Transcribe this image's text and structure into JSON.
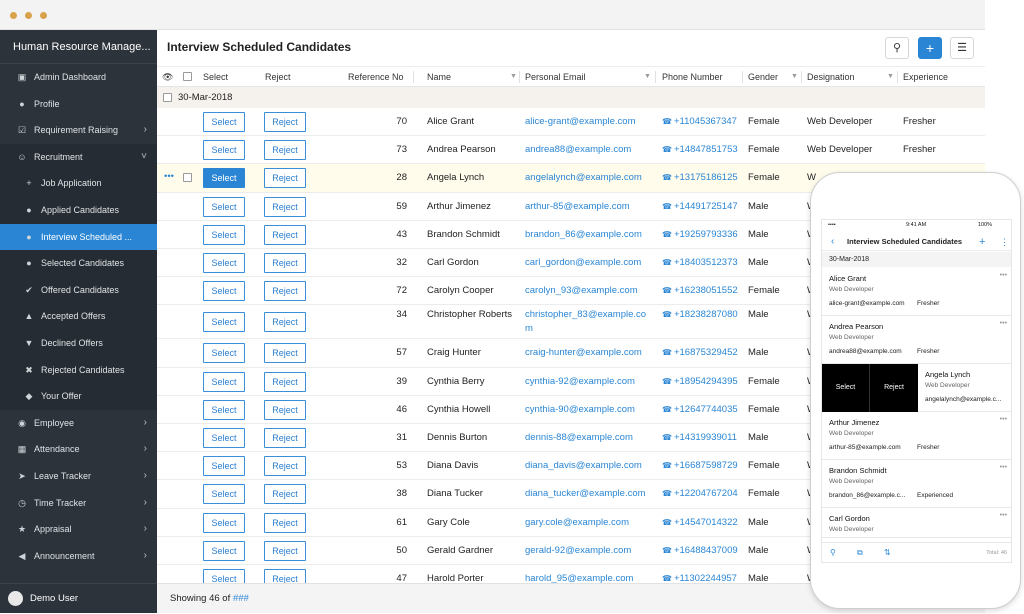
{
  "window": {
    "dots_color": "#d9a24a"
  },
  "sidebar": {
    "title": "Human Resource Manage...",
    "items": [
      {
        "label": "Admin Dashboard",
        "icon": "dashboard-icon"
      },
      {
        "label": "Profile",
        "icon": "user-icon"
      },
      {
        "label": "Requirement Raising",
        "icon": "checkbox-icon",
        "has_arrow": true
      },
      {
        "label": "Recruitment",
        "icon": "recruitment-icon",
        "expanded": true
      },
      {
        "label": "Job Application",
        "icon": "plus-icon",
        "sub": true
      },
      {
        "label": "Applied Candidates",
        "icon": "users-icon",
        "sub": true
      },
      {
        "label": "Interview Scheduled ...",
        "icon": "users-icon",
        "sub": true,
        "active": true
      },
      {
        "label": "Selected Candidates",
        "icon": "users-icon",
        "sub": true
      },
      {
        "label": "Offered Candidates",
        "icon": "check-circle-icon",
        "sub": true
      },
      {
        "label": "Accepted Offers",
        "icon": "thumbs-up-icon",
        "sub": true
      },
      {
        "label": "Declined Offers",
        "icon": "thumbs-down-icon",
        "sub": true
      },
      {
        "label": "Rejected Candidates",
        "icon": "x-icon",
        "sub": true
      },
      {
        "label": "Your Offer",
        "icon": "tag-icon",
        "sub": true
      },
      {
        "label": "Employee",
        "icon": "employee-icon",
        "has_arrow": true
      },
      {
        "label": "Attendance",
        "icon": "calendar-icon",
        "has_arrow": true
      },
      {
        "label": "Leave Tracker",
        "icon": "plane-icon",
        "has_arrow": true
      },
      {
        "label": "Time Tracker",
        "icon": "clock-icon",
        "has_arrow": true
      },
      {
        "label": "Appraisal",
        "icon": "star-icon",
        "has_arrow": true
      },
      {
        "label": "Announcement",
        "icon": "megaphone-icon",
        "has_arrow": true
      }
    ],
    "user": "Demo User"
  },
  "main": {
    "title": "Interview Scheduled Candidates",
    "columns": [
      "Select",
      "Reject",
      "Reference No",
      "Name",
      "Personal Email",
      "Phone Number",
      "Gender",
      "Designation",
      "Experience"
    ],
    "group_label": "30-Mar-2018",
    "select_label": "Select",
    "reject_label": "Reject",
    "rows": [
      {
        "ref": "70",
        "name": "Alice Grant",
        "email": "alice-grant@example.com",
        "phone": "+11045367347",
        "gender": "Female",
        "designation": "Web Developer",
        "experience": "Fresher"
      },
      {
        "ref": "73",
        "name": "Andrea Pearson",
        "email": "andrea88@example.com",
        "phone": "+14847851753",
        "gender": "Female",
        "designation": "Web Developer",
        "experience": "Fresher"
      },
      {
        "ref": "28",
        "name": "Angela Lynch",
        "email": "angelalynch@example.com",
        "phone": "+13175186125",
        "gender": "Female",
        "designation": "W",
        "experience": "",
        "highlight": true
      },
      {
        "ref": "59",
        "name": "Arthur Jimenez",
        "email": "arthur-85@example.com",
        "phone": "+14491725147",
        "gender": "Male",
        "designation": "W",
        "experience": ""
      },
      {
        "ref": "43",
        "name": "Brandon Schmidt",
        "email": "brandon_86@example.com",
        "phone": "+19259793336",
        "gender": "Male",
        "designation": "W",
        "experience": ""
      },
      {
        "ref": "32",
        "name": "Carl Gordon",
        "email": "carl_gordon@example.com",
        "phone": "+18403512373",
        "gender": "Male",
        "designation": "W",
        "experience": ""
      },
      {
        "ref": "72",
        "name": "Carolyn Cooper",
        "email": "carolyn_93@example.com",
        "phone": "+16238051552",
        "gender": "Female",
        "designation": "W",
        "experience": ""
      },
      {
        "ref": "34",
        "name": "Christopher Roberts",
        "email": "christopher_83@example.co",
        "email2": "m",
        "phone": "+18238287080",
        "gender": "Male",
        "designation": "W",
        "experience": "",
        "tall": true
      },
      {
        "ref": "57",
        "name": "Craig Hunter",
        "email": "craig-hunter@example.com",
        "phone": "+16875329452",
        "gender": "Male",
        "designation": "W",
        "experience": ""
      },
      {
        "ref": "39",
        "name": "Cynthia Berry",
        "email": "cynthia-92@example.com",
        "phone": "+18954294395",
        "gender": "Female",
        "designation": "W",
        "experience": ""
      },
      {
        "ref": "46",
        "name": "Cynthia Howell",
        "email": "cynthia-90@example.com",
        "phone": "+12647744035",
        "gender": "Female",
        "designation": "W",
        "experience": ""
      },
      {
        "ref": "31",
        "name": "Dennis Burton",
        "email": "dennis-88@example.com",
        "phone": "+14319939011",
        "gender": "Male",
        "designation": "W",
        "experience": ""
      },
      {
        "ref": "53",
        "name": "Diana Davis",
        "email": "diana_davis@example.com",
        "phone": "+16687598729",
        "gender": "Female",
        "designation": "W",
        "experience": ""
      },
      {
        "ref": "38",
        "name": "Diana Tucker",
        "email": "diana_tucker@example.com",
        "phone": "+12204767204",
        "gender": "Female",
        "designation": "W",
        "experience": ""
      },
      {
        "ref": "61",
        "name": "Gary Cole",
        "email": "gary.cole@example.com",
        "phone": "+14547014322",
        "gender": "Male",
        "designation": "W",
        "experience": ""
      },
      {
        "ref": "50",
        "name": "Gerald Gardner",
        "email": "gerald-92@example.com",
        "phone": "+16488437009",
        "gender": "Male",
        "designation": "W",
        "experience": ""
      },
      {
        "ref": "47",
        "name": "Harold Porter",
        "email": "harold_95@example.com",
        "phone": "+11302244957",
        "gender": "Male",
        "designation": "W",
        "experience": ""
      }
    ],
    "footer": {
      "prefix": "Showing 46 of",
      "total": "###"
    }
  },
  "mobile": {
    "status_time": "9:41 AM",
    "status_battery": "100%",
    "title": "Interview Scheduled Candidates",
    "date": "30-Mar-2018",
    "swipe_select": "Select",
    "swipe_reject": "Reject",
    "cards": [
      {
        "name": "Alice Grant",
        "role": "Web Developer",
        "email": "alice-grant@example.com",
        "exp": "Fresher"
      },
      {
        "name": "Andrea Pearson",
        "role": "Web Developer",
        "email": "andrea88@example.com",
        "exp": "Fresher"
      },
      {
        "name": "Angela Lynch",
        "role": "Web Developer",
        "email": "angelalynch@example.c...",
        "exp": "",
        "swiped": true
      },
      {
        "name": "Arthur Jimenez",
        "role": "Web Developer",
        "email": "arthur-85@example.com",
        "exp": "Fresher"
      },
      {
        "name": "Brandon Schmidt",
        "role": "Web Developer",
        "email": "brandon_86@example.c...",
        "exp": "Experienced"
      },
      {
        "name": "Carl Gordon",
        "role": "Web Developer",
        "email": "",
        "exp": ""
      }
    ],
    "total": "Total: 46"
  }
}
